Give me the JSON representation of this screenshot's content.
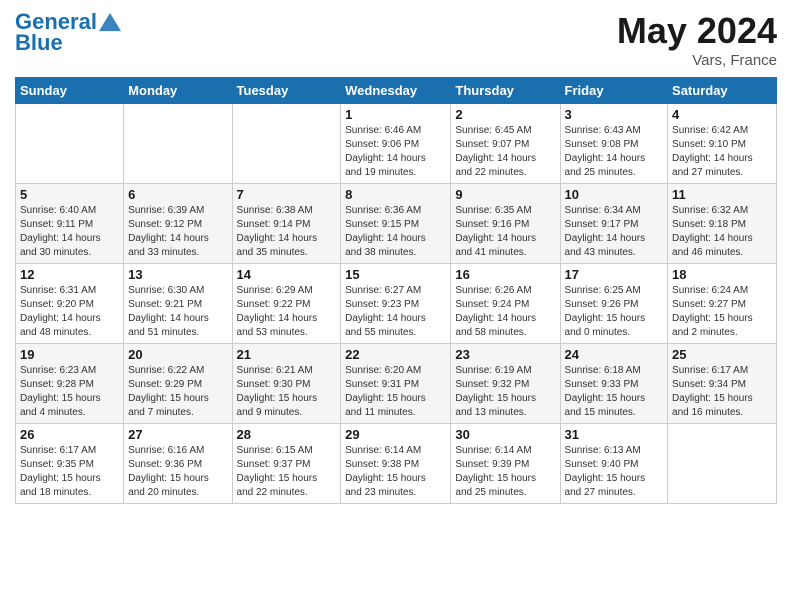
{
  "header": {
    "logo_line1": "General",
    "logo_line2": "Blue",
    "month": "May 2024",
    "location": "Vars, France"
  },
  "weekdays": [
    "Sunday",
    "Monday",
    "Tuesday",
    "Wednesday",
    "Thursday",
    "Friday",
    "Saturday"
  ],
  "weeks": [
    [
      {
        "day": "",
        "info": ""
      },
      {
        "day": "",
        "info": ""
      },
      {
        "day": "",
        "info": ""
      },
      {
        "day": "1",
        "info": "Sunrise: 6:46 AM\nSunset: 9:06 PM\nDaylight: 14 hours\nand 19 minutes."
      },
      {
        "day": "2",
        "info": "Sunrise: 6:45 AM\nSunset: 9:07 PM\nDaylight: 14 hours\nand 22 minutes."
      },
      {
        "day": "3",
        "info": "Sunrise: 6:43 AM\nSunset: 9:08 PM\nDaylight: 14 hours\nand 25 minutes."
      },
      {
        "day": "4",
        "info": "Sunrise: 6:42 AM\nSunset: 9:10 PM\nDaylight: 14 hours\nand 27 minutes."
      }
    ],
    [
      {
        "day": "5",
        "info": "Sunrise: 6:40 AM\nSunset: 9:11 PM\nDaylight: 14 hours\nand 30 minutes."
      },
      {
        "day": "6",
        "info": "Sunrise: 6:39 AM\nSunset: 9:12 PM\nDaylight: 14 hours\nand 33 minutes."
      },
      {
        "day": "7",
        "info": "Sunrise: 6:38 AM\nSunset: 9:14 PM\nDaylight: 14 hours\nand 35 minutes."
      },
      {
        "day": "8",
        "info": "Sunrise: 6:36 AM\nSunset: 9:15 PM\nDaylight: 14 hours\nand 38 minutes."
      },
      {
        "day": "9",
        "info": "Sunrise: 6:35 AM\nSunset: 9:16 PM\nDaylight: 14 hours\nand 41 minutes."
      },
      {
        "day": "10",
        "info": "Sunrise: 6:34 AM\nSunset: 9:17 PM\nDaylight: 14 hours\nand 43 minutes."
      },
      {
        "day": "11",
        "info": "Sunrise: 6:32 AM\nSunset: 9:18 PM\nDaylight: 14 hours\nand 46 minutes."
      }
    ],
    [
      {
        "day": "12",
        "info": "Sunrise: 6:31 AM\nSunset: 9:20 PM\nDaylight: 14 hours\nand 48 minutes."
      },
      {
        "day": "13",
        "info": "Sunrise: 6:30 AM\nSunset: 9:21 PM\nDaylight: 14 hours\nand 51 minutes."
      },
      {
        "day": "14",
        "info": "Sunrise: 6:29 AM\nSunset: 9:22 PM\nDaylight: 14 hours\nand 53 minutes."
      },
      {
        "day": "15",
        "info": "Sunrise: 6:27 AM\nSunset: 9:23 PM\nDaylight: 14 hours\nand 55 minutes."
      },
      {
        "day": "16",
        "info": "Sunrise: 6:26 AM\nSunset: 9:24 PM\nDaylight: 14 hours\nand 58 minutes."
      },
      {
        "day": "17",
        "info": "Sunrise: 6:25 AM\nSunset: 9:26 PM\nDaylight: 15 hours\nand 0 minutes."
      },
      {
        "day": "18",
        "info": "Sunrise: 6:24 AM\nSunset: 9:27 PM\nDaylight: 15 hours\nand 2 minutes."
      }
    ],
    [
      {
        "day": "19",
        "info": "Sunrise: 6:23 AM\nSunset: 9:28 PM\nDaylight: 15 hours\nand 4 minutes."
      },
      {
        "day": "20",
        "info": "Sunrise: 6:22 AM\nSunset: 9:29 PM\nDaylight: 15 hours\nand 7 minutes."
      },
      {
        "day": "21",
        "info": "Sunrise: 6:21 AM\nSunset: 9:30 PM\nDaylight: 15 hours\nand 9 minutes."
      },
      {
        "day": "22",
        "info": "Sunrise: 6:20 AM\nSunset: 9:31 PM\nDaylight: 15 hours\nand 11 minutes."
      },
      {
        "day": "23",
        "info": "Sunrise: 6:19 AM\nSunset: 9:32 PM\nDaylight: 15 hours\nand 13 minutes."
      },
      {
        "day": "24",
        "info": "Sunrise: 6:18 AM\nSunset: 9:33 PM\nDaylight: 15 hours\nand 15 minutes."
      },
      {
        "day": "25",
        "info": "Sunrise: 6:17 AM\nSunset: 9:34 PM\nDaylight: 15 hours\nand 16 minutes."
      }
    ],
    [
      {
        "day": "26",
        "info": "Sunrise: 6:17 AM\nSunset: 9:35 PM\nDaylight: 15 hours\nand 18 minutes."
      },
      {
        "day": "27",
        "info": "Sunrise: 6:16 AM\nSunset: 9:36 PM\nDaylight: 15 hours\nand 20 minutes."
      },
      {
        "day": "28",
        "info": "Sunrise: 6:15 AM\nSunset: 9:37 PM\nDaylight: 15 hours\nand 22 minutes."
      },
      {
        "day": "29",
        "info": "Sunrise: 6:14 AM\nSunset: 9:38 PM\nDaylight: 15 hours\nand 23 minutes."
      },
      {
        "day": "30",
        "info": "Sunrise: 6:14 AM\nSunset: 9:39 PM\nDaylight: 15 hours\nand 25 minutes."
      },
      {
        "day": "31",
        "info": "Sunrise: 6:13 AM\nSunset: 9:40 PM\nDaylight: 15 hours\nand 27 minutes."
      },
      {
        "day": "",
        "info": ""
      }
    ]
  ]
}
